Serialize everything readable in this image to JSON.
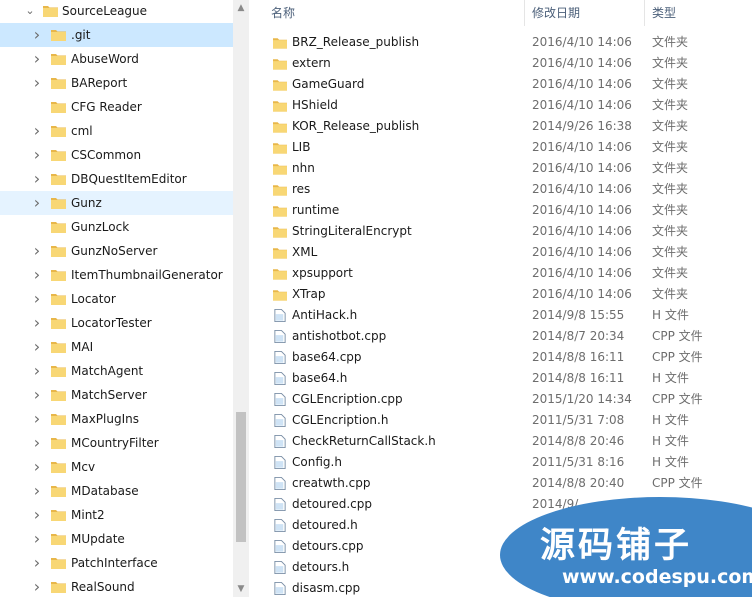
{
  "tree": {
    "root": {
      "label": "SourceLeague",
      "expanded": true
    },
    "selected": ".git",
    "hovered": "Gunz",
    "items": [
      {
        "label": ".git",
        "expandable": true
      },
      {
        "label": "AbuseWord",
        "expandable": true
      },
      {
        "label": "BAReport",
        "expandable": true
      },
      {
        "label": "CFG Reader",
        "expandable": false
      },
      {
        "label": "cml",
        "expandable": true
      },
      {
        "label": "CSCommon",
        "expandable": true
      },
      {
        "label": "DBQuestItemEditor",
        "expandable": true
      },
      {
        "label": "Gunz",
        "expandable": true
      },
      {
        "label": "GunzLock",
        "expandable": false
      },
      {
        "label": "GunzNoServer",
        "expandable": true
      },
      {
        "label": "ItemThumbnailGenerator",
        "expandable": true
      },
      {
        "label": "Locator",
        "expandable": true
      },
      {
        "label": "LocatorTester",
        "expandable": true
      },
      {
        "label": "MAI",
        "expandable": true
      },
      {
        "label": "MatchAgent",
        "expandable": true
      },
      {
        "label": "MatchServer",
        "expandable": true
      },
      {
        "label": "MaxPlugIns",
        "expandable": true
      },
      {
        "label": "MCountryFilter",
        "expandable": true
      },
      {
        "label": "Mcv",
        "expandable": true
      },
      {
        "label": "MDatabase",
        "expandable": true
      },
      {
        "label": "Mint2",
        "expandable": true
      },
      {
        "label": "MUpdate",
        "expandable": true
      },
      {
        "label": "PatchInterface",
        "expandable": true
      },
      {
        "label": "RealSound",
        "expandable": true
      }
    ]
  },
  "columns": {
    "name": "名称",
    "modified": "修改日期",
    "type": "类型"
  },
  "files": [
    {
      "name": "BRZ_Release_publish",
      "date": "2016/4/10 14:06",
      "type": "文件夹",
      "kind": "folder"
    },
    {
      "name": "extern",
      "date": "2016/4/10 14:06",
      "type": "文件夹",
      "kind": "folder"
    },
    {
      "name": "GameGuard",
      "date": "2016/4/10 14:06",
      "type": "文件夹",
      "kind": "folder"
    },
    {
      "name": "HShield",
      "date": "2016/4/10 14:06",
      "type": "文件夹",
      "kind": "folder"
    },
    {
      "name": "KOR_Release_publish",
      "date": "2014/9/26 16:38",
      "type": "文件夹",
      "kind": "folder"
    },
    {
      "name": "LIB",
      "date": "2016/4/10 14:06",
      "type": "文件夹",
      "kind": "folder"
    },
    {
      "name": "nhn",
      "date": "2016/4/10 14:06",
      "type": "文件夹",
      "kind": "folder"
    },
    {
      "name": "res",
      "date": "2016/4/10 14:06",
      "type": "文件夹",
      "kind": "folder"
    },
    {
      "name": "runtime",
      "date": "2016/4/10 14:06",
      "type": "文件夹",
      "kind": "folder"
    },
    {
      "name": "StringLiteralEncrypt",
      "date": "2016/4/10 14:06",
      "type": "文件夹",
      "kind": "folder"
    },
    {
      "name": "XML",
      "date": "2016/4/10 14:06",
      "type": "文件夹",
      "kind": "folder"
    },
    {
      "name": "xpsupport",
      "date": "2016/4/10 14:06",
      "type": "文件夹",
      "kind": "folder"
    },
    {
      "name": "XTrap",
      "date": "2016/4/10 14:06",
      "type": "文件夹",
      "kind": "folder"
    },
    {
      "name": "AntiHack.h",
      "date": "2014/9/8 15:55",
      "type": "H 文件",
      "kind": "file"
    },
    {
      "name": "antishotbot.cpp",
      "date": "2014/8/7 20:34",
      "type": "CPP 文件",
      "kind": "file"
    },
    {
      "name": "base64.cpp",
      "date": "2014/8/8 16:11",
      "type": "CPP 文件",
      "kind": "file"
    },
    {
      "name": "base64.h",
      "date": "2014/8/8 16:11",
      "type": "H 文件",
      "kind": "file"
    },
    {
      "name": "CGLEncription.cpp",
      "date": "2015/1/20 14:34",
      "type": "CPP 文件",
      "kind": "file"
    },
    {
      "name": "CGLEncription.h",
      "date": "2011/5/31 7:08",
      "type": "H 文件",
      "kind": "file"
    },
    {
      "name": "CheckReturnCallStack.h",
      "date": "2014/8/8 20:46",
      "type": "H 文件",
      "kind": "file"
    },
    {
      "name": "Config.h",
      "date": "2011/5/31 8:16",
      "type": "H 文件",
      "kind": "file"
    },
    {
      "name": "creatwth.cpp",
      "date": "2014/8/8 20:40",
      "type": "CPP 文件",
      "kind": "file"
    },
    {
      "name": "detoured.cpp",
      "date": "2014/9/",
      "type": "",
      "kind": "file"
    },
    {
      "name": "detoured.h",
      "date": "",
      "type": "",
      "kind": "file"
    },
    {
      "name": "detours.cpp",
      "date": "",
      "type": "",
      "kind": "file"
    },
    {
      "name": "detours.h",
      "date": "",
      "type": "",
      "kind": "file"
    },
    {
      "name": "disasm.cpp",
      "date": "",
      "type": "",
      "kind": "file"
    }
  ],
  "watermark": {
    "title": "源码铺子",
    "url": "www.codespu.com"
  },
  "colors": {
    "selection": "#cce8ff",
    "hover": "#e5f3ff",
    "folder": "#f8d775",
    "folder_dark": "#e8b74a",
    "watermark": "#3f86c8"
  }
}
